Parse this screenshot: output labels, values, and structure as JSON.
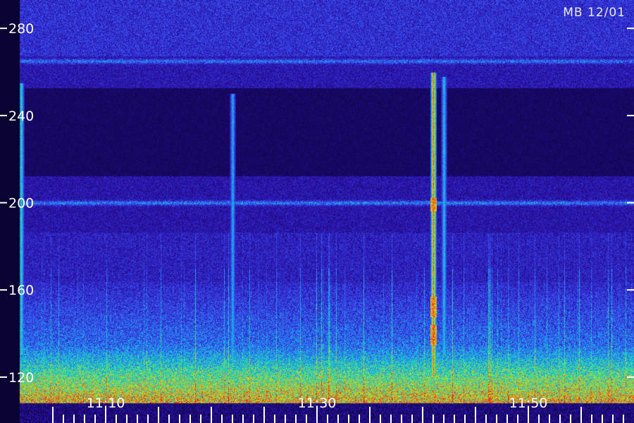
{
  "stamp": "MB 12/01",
  "chart_data": {
    "type": "heatmap",
    "title": "",
    "xlabel": "",
    "ylabel": "",
    "x_ticks": [
      "11:10",
      "11:30",
      "11:50"
    ],
    "y_ticks": [
      120,
      160,
      200,
      240,
      280
    ],
    "y_range": [
      108,
      293
    ],
    "grid": false,
    "colormap": [
      "#0a0230",
      "#2a10a8",
      "#3a4cf0",
      "#1aa8f0",
      "#20e0a0",
      "#c8e020",
      "#f08020",
      "#e02010"
    ],
    "features": [
      {
        "kind": "vertical-band",
        "time": "11:41",
        "y_range": [
          120,
          260
        ],
        "peak_level": 1.0
      },
      {
        "kind": "vertical-band",
        "time": "11:42",
        "y_range": [
          130,
          258
        ],
        "peak_level": 0.55
      },
      {
        "kind": "vertical-band",
        "time": "11:02",
        "y_range": [
          130,
          255
        ],
        "peak_level": 0.6
      },
      {
        "kind": "vertical-band",
        "time": "11:22",
        "y_range": [
          125,
          250
        ],
        "peak_level": 0.5
      },
      {
        "kind": "horizontal-band",
        "y": 200,
        "level": 0.35
      },
      {
        "kind": "horizontal-band",
        "y": 265,
        "level": 0.3
      },
      {
        "kind": "broadband-floor",
        "y_range": [
          108,
          135
        ],
        "level": 0.45
      }
    ]
  }
}
